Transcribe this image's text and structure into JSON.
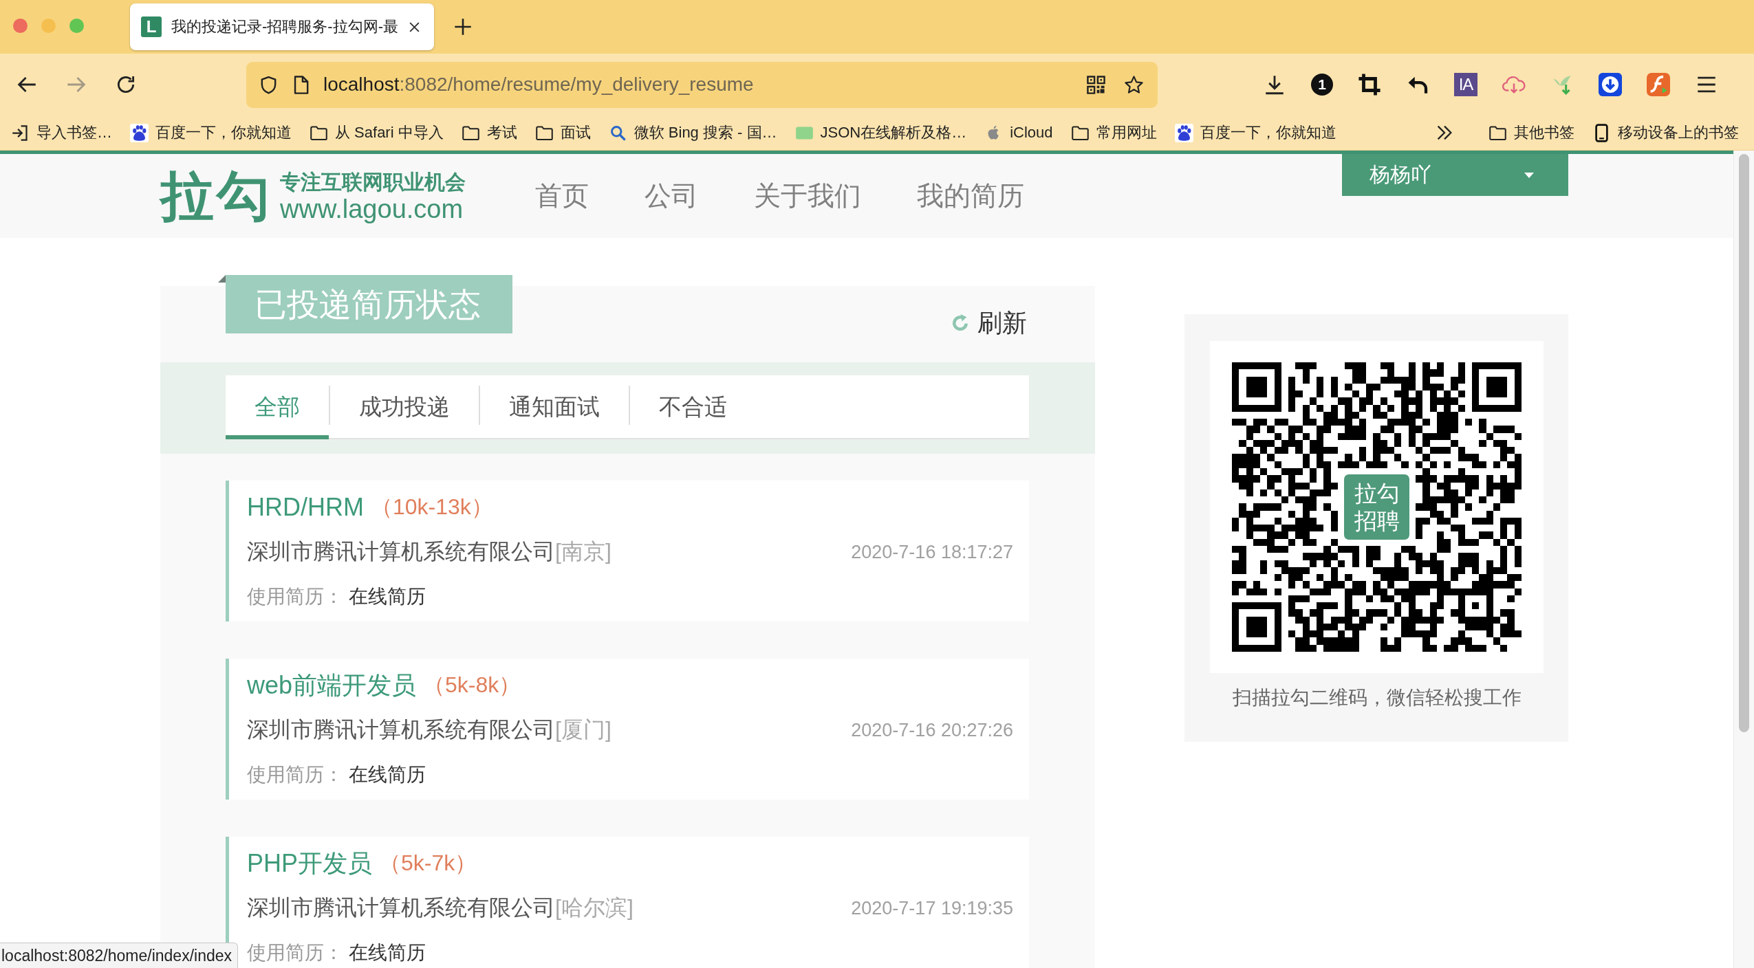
{
  "browser": {
    "tab": {
      "favicon": "L",
      "title": "我的投递记录-招聘服务-拉勾网-最",
      "selected": true
    },
    "forward": {
      "disabled": true
    },
    "address": {
      "host": "localhost",
      "path": ":8082/home/resume/my_delivery_resume"
    },
    "extension_labels": [
      "1",
      "IA"
    ],
    "bookmarks": [
      {
        "kind": "import",
        "label": "导入书签…"
      },
      {
        "kind": "paw",
        "label": "百度一下，你就知道"
      },
      {
        "kind": "folder",
        "label": "从 Safari 中导入"
      },
      {
        "kind": "folder",
        "label": "考试"
      },
      {
        "kind": "folder",
        "label": "面试"
      },
      {
        "kind": "search",
        "label": "微软 Bing 搜索 - 国…"
      },
      {
        "kind": "json",
        "label": "JSON在线解析及格…"
      },
      {
        "kind": "apple",
        "label": "iCloud"
      },
      {
        "kind": "folder",
        "label": "常用网址"
      },
      {
        "kind": "paw",
        "label": "百度一下，你就知道"
      }
    ],
    "other_bookmarks": [
      {
        "kind": "folder",
        "label": "其他书签"
      },
      {
        "kind": "phone",
        "label": "移动设备上的书签"
      }
    ],
    "status_url": "localhost:8082/home/index/index"
  },
  "header": {
    "logo": {
      "mark": "拉勾",
      "slogan": "专注互联网职业机会",
      "domain": "www.lagou.com"
    },
    "nav": [
      {
        "label": "首页"
      },
      {
        "label": "公司"
      },
      {
        "label": "关于我们"
      },
      {
        "label": "我的简历"
      }
    ],
    "user": {
      "name": "杨杨吖"
    }
  },
  "delivery": {
    "title": "已投递简历状态",
    "refresh": "刷新",
    "tabs": [
      {
        "label": "全部",
        "selected": true
      },
      {
        "label": "成功投递",
        "selected": false
      },
      {
        "label": "通知面试",
        "selected": false
      },
      {
        "label": "不合适",
        "selected": false
      }
    ],
    "records": [
      {
        "position": "HRD/HRM",
        "salary": "（10k-13k）",
        "company": "深圳市腾讯计算机系统有限公司",
        "city": "[南京]",
        "time": "2020-7-16 18:17:27",
        "resume_label": "使用简历：",
        "resume": "在线简历"
      },
      {
        "position": "web前端开发员",
        "salary": "（5k-8k）",
        "company": "深圳市腾讯计算机系统有限公司",
        "city": "[厦门]",
        "time": "2020-7-16 20:27:26",
        "resume_label": "使用简历：",
        "resume": "在线简历"
      },
      {
        "position": "PHP开发员",
        "salary": "（5k-7k）",
        "company": "深圳市腾讯计算机系统有限公司",
        "city": "[哈尔滨]",
        "time": "2020-7-17 19:19:35",
        "resume_label": "使用简历：",
        "resume": "在线简历"
      }
    ]
  },
  "qr_panel": {
    "badge": "拉勾招聘",
    "caption": "扫描拉勾二维码，微信轻松搜工作"
  }
}
